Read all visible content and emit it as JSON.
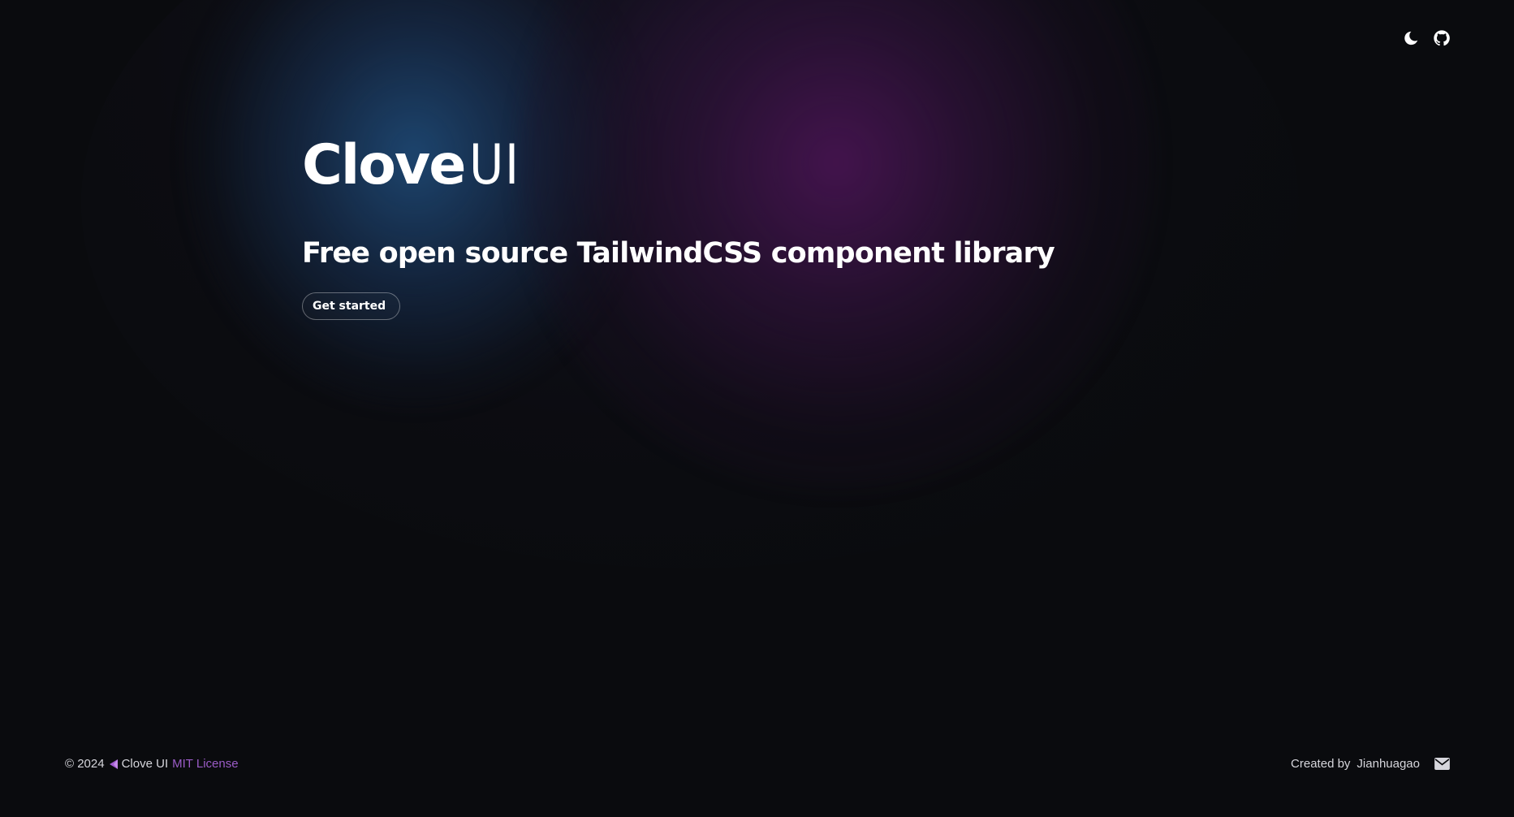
{
  "header": {
    "theme_toggle_icon": "moon-icon",
    "github_icon": "github-icon"
  },
  "hero": {
    "logo_bold": "Clove",
    "logo_light": "UI",
    "tagline": "Free open source TailwindCSS component library",
    "cta_label": "Get started"
  },
  "footer": {
    "copyright": "© 2024",
    "brand_icon": "clove-logo-icon",
    "brand_name": "Clove UI",
    "license_label": "MIT License",
    "created_by_label": "Created by",
    "author": "Jianhuagao",
    "mail_icon": "mail-icon"
  },
  "colors": {
    "background": "#0a0b0e",
    "glow_blue": "#1e4873",
    "glow_purple": "#461450",
    "license_link": "#9b5cc7",
    "text": "#ffffff"
  }
}
